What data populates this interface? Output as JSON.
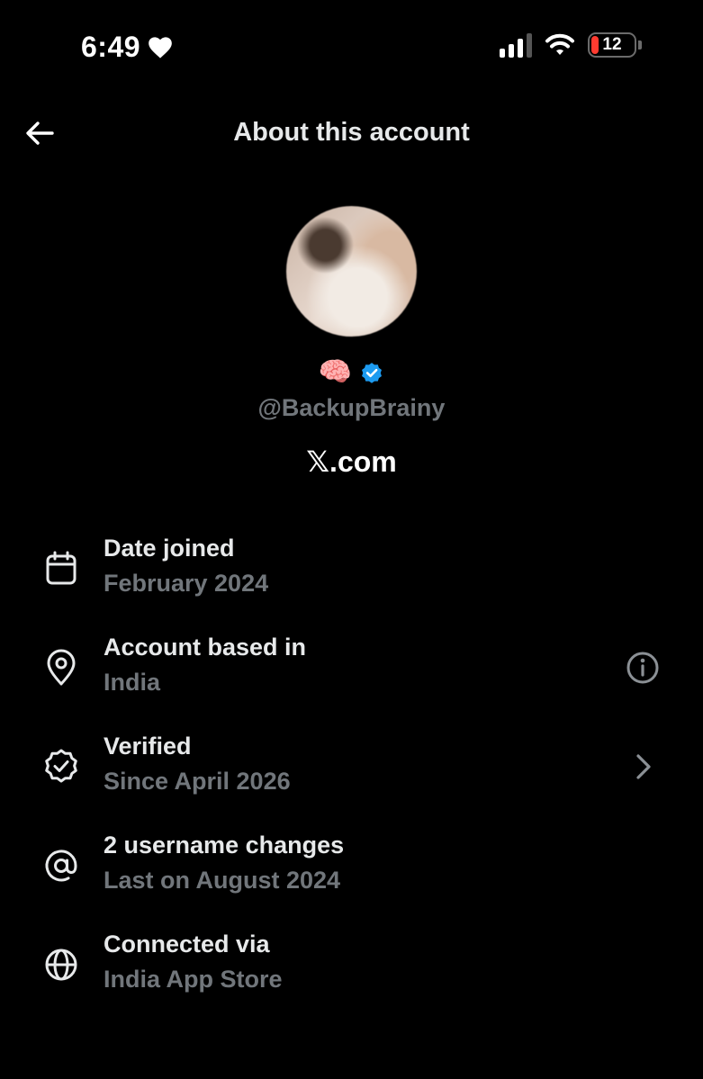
{
  "status_bar": {
    "time": "6:49",
    "battery": "12",
    "icons": [
      "heart-icon",
      "signal-icon",
      "wifi-icon",
      "battery-icon"
    ]
  },
  "header": {
    "title": "About this account",
    "back_icon": "back-arrow-icon"
  },
  "profile": {
    "display_name_emoji": "🧠",
    "verified": true,
    "verified_color": "#1d9bf0",
    "handle": "@BackupBrainy",
    "site": "𝕏.com"
  },
  "details": [
    {
      "icon": "calendar-icon",
      "label": "Date joined",
      "value": "February 2024"
    },
    {
      "icon": "location-pin-icon",
      "label": "Account based in",
      "value": "India",
      "trailing": "info-icon"
    },
    {
      "icon": "verified-badge-icon",
      "label": "Verified",
      "value": "Since April 2026",
      "trailing": "chevron-right-icon"
    },
    {
      "icon": "at-sign-icon",
      "label": "2 username changes",
      "value": "Last on August 2024"
    },
    {
      "icon": "globe-icon",
      "label": "Connected via",
      "value": "India App Store"
    }
  ],
  "colors": {
    "background": "#000000",
    "primary_text": "#e7e9ea",
    "secondary_text": "#71767b",
    "accent": "#1d9bf0",
    "battery_low": "#ff3b30"
  }
}
